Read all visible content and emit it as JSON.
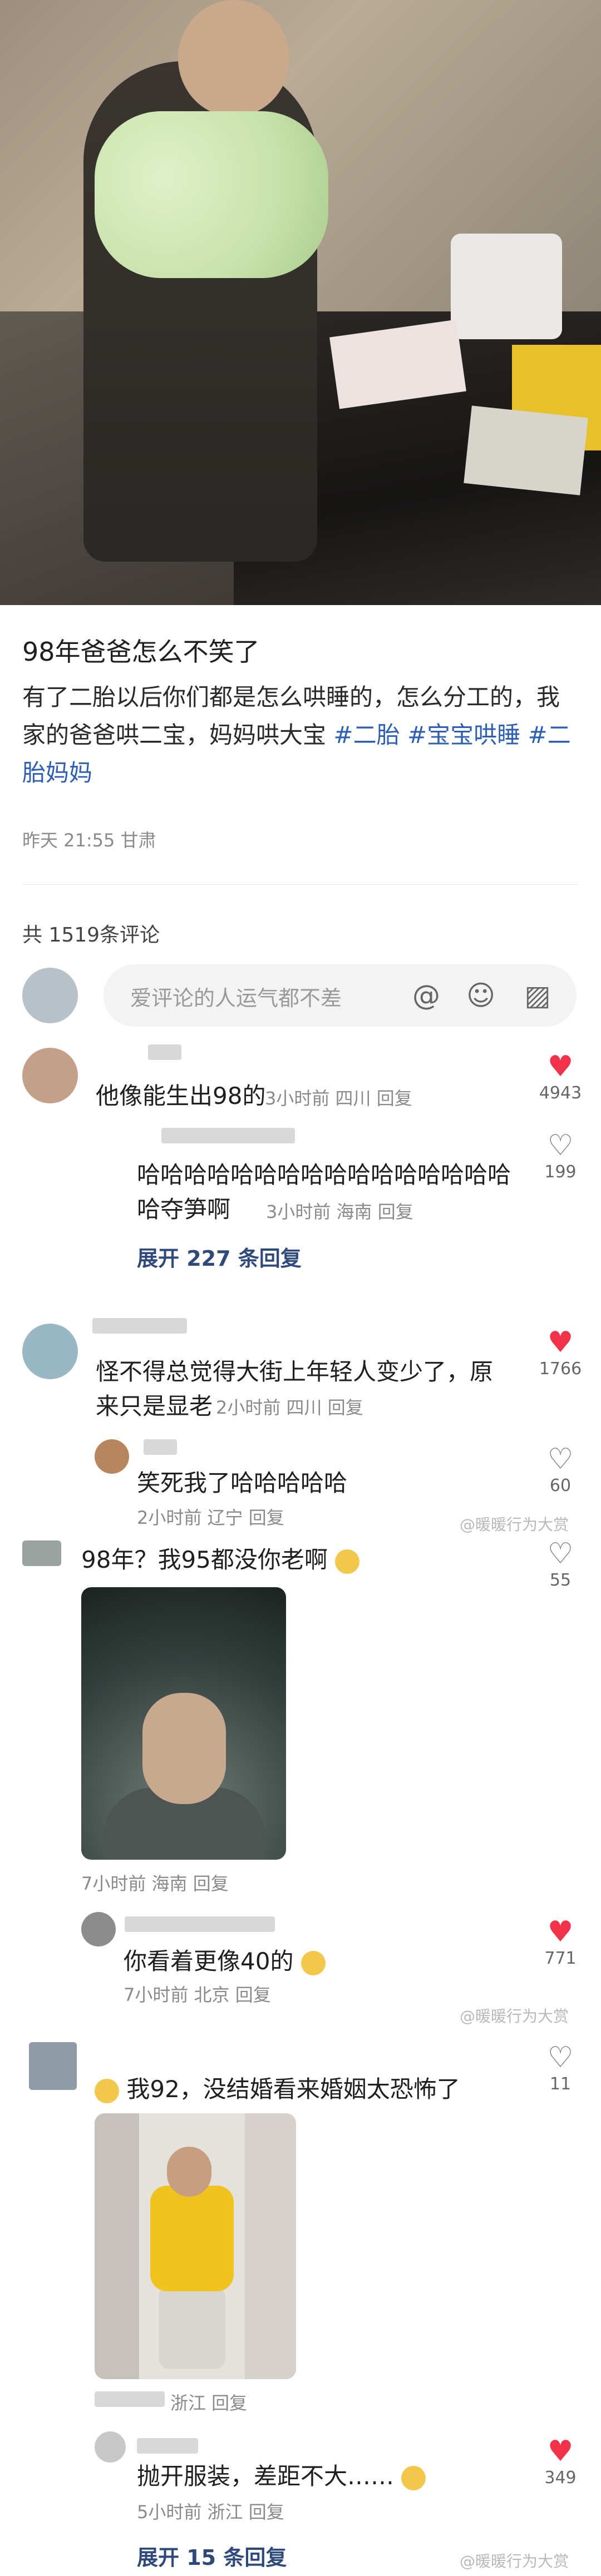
{
  "post": {
    "title": "98年爸爸怎么不笑了",
    "body_text": "有了二胎以后你们都是怎么哄睡的，怎么分工的，我家的爸爸哄二宝，妈妈哄大宝",
    "tags": [
      "#二胎",
      "#宝宝哄睡",
      "#二胎妈妈"
    ],
    "meta": "昨天 21:55 甘肃"
  },
  "comments_header": {
    "count_text": "共 1519条评论"
  },
  "input": {
    "placeholder": "爱评论的人运气都不差"
  },
  "icons": {
    "at": "at-icon",
    "emoji": "smile-icon",
    "image": "image-icon",
    "like": "heart-icon"
  },
  "colors": {
    "liked": "#f0334b",
    "link": "#2f5fb3",
    "expand": "#2f4a7a"
  },
  "comments": [
    {
      "text": "他像能生出98的",
      "meta": "3小时前  四川  回复",
      "likes": "4943",
      "liked": true,
      "replies": [
        {
          "text": "哈哈哈哈哈哈哈哈哈哈哈哈哈哈哈哈哈夺笋啊",
          "meta": "3小时前   海南  回复",
          "likes": "199",
          "liked": false
        }
      ],
      "expand": "展开 227 条回复"
    },
    {
      "text": "怪不得总觉得大街上年轻人变少了，原来只是显老",
      "meta": "2小时前  四川  回复",
      "likes": "1766",
      "liked": true,
      "replies": [
        {
          "text": "笑死我了哈哈哈哈哈",
          "meta": "2小时前  辽宁  回复",
          "likes": "60",
          "liked": false
        }
      ]
    },
    {
      "text": "98年？我95都没你老啊",
      "meta": "7小时前  海南  回复",
      "likes": "55",
      "liked": false,
      "replies": [
        {
          "text": "你看着更像40的",
          "meta": "7小时前  北京  回复",
          "likes": "771",
          "liked": true
        }
      ]
    },
    {
      "text": "我92，没结婚看来婚姻太恐怖了",
      "meta": "浙江  回复",
      "likes": "11",
      "liked": false,
      "replies": [
        {
          "text": "抛开服装，差距不大……",
          "meta": "5小时前  浙江  回复",
          "likes": "349",
          "liked": true
        }
      ],
      "expand": "展开 15 条回复"
    }
  ],
  "watermarks": [
    "@暖暖行为大赏",
    "@暖暖行为大赏",
    "@暖暖行为大赏"
  ]
}
